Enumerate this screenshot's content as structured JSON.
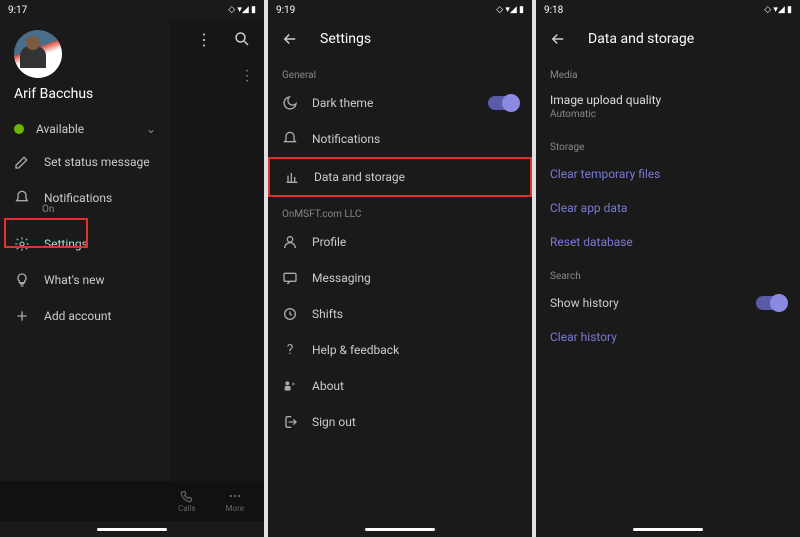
{
  "screen1": {
    "time": "9:17",
    "username": "Arif Bacchus",
    "status": "Available",
    "menu": {
      "setStatus": "Set status message",
      "notifications": "Notifications",
      "notificationsSub": "On",
      "settings": "Settings",
      "whatsNew": "What's new",
      "addAccount": "Add account"
    },
    "bottomNav": {
      "calls": "Calls",
      "more": "More"
    }
  },
  "screen2": {
    "time": "9:19",
    "title": "Settings",
    "general": {
      "header": "General",
      "darkTheme": "Dark theme",
      "notifications": "Notifications",
      "dataStorage": "Data and storage"
    },
    "org": {
      "header": "OnMSFT.com LLC",
      "profile": "Profile",
      "messaging": "Messaging",
      "shifts": "Shifts",
      "help": "Help & feedback",
      "about": "About",
      "signOut": "Sign out"
    }
  },
  "screen3": {
    "time": "9:18",
    "title": "Data and storage",
    "media": {
      "header": "Media",
      "uploadQuality": "Image upload quality",
      "uploadQualitySub": "Automatic"
    },
    "storage": {
      "header": "Storage",
      "clearTemp": "Clear temporary files",
      "clearAppData": "Clear app data",
      "resetDb": "Reset database"
    },
    "search": {
      "header": "Search",
      "showHistory": "Show history",
      "clearHistory": "Clear history"
    }
  }
}
